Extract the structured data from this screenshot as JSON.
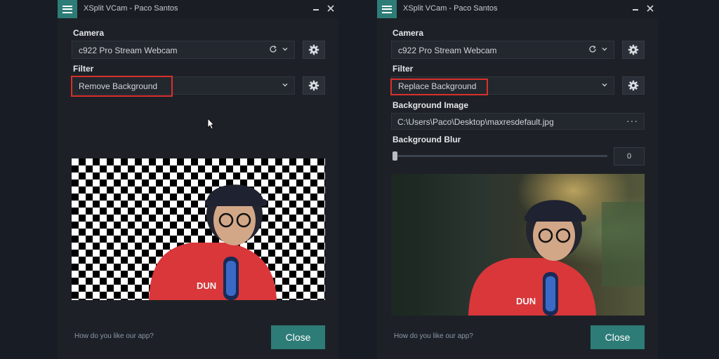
{
  "left_window": {
    "title": "XSplit VCam - Paco Santos",
    "camera_label": "Camera",
    "camera_value": "c922 Pro Stream Webcam",
    "filter_label": "Filter",
    "filter_value": "Remove Background",
    "feedback_text": "How do you like our app?",
    "close_label": "Close"
  },
  "right_window": {
    "title": "XSplit VCam - Paco Santos",
    "camera_label": "Camera",
    "camera_value": "c922 Pro Stream Webcam",
    "filter_label": "Filter",
    "filter_value": "Replace Background",
    "bg_image_label": "Background Image",
    "bg_image_path": "C:\\Users\\Paco\\Desktop\\maxresdefault.jpg",
    "browse_label": "···",
    "bg_blur_label": "Background Blur",
    "bg_blur_value": "0",
    "feedback_text": "How do you like our app?",
    "close_label": "Close"
  },
  "colors": {
    "accent": "#2e7c78",
    "highlight": "#d8302c",
    "window_bg": "#1d2127"
  }
}
